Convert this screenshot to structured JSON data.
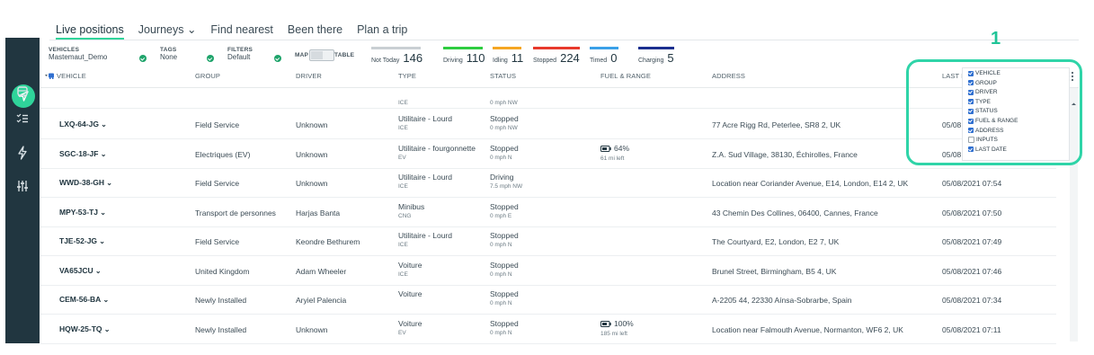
{
  "tabs": [
    {
      "label": "Live positions"
    },
    {
      "label": "Journeys ⌄"
    },
    {
      "label": "Find nearest"
    },
    {
      "label": "Been there"
    },
    {
      "label": "Plan a trip"
    }
  ],
  "filters": {
    "vehicles_label": "VEHICLES",
    "vehicles_value": "Mastemaut_Demo",
    "tags_label": "TAGS",
    "tags_value": "None",
    "filters_label": "FILTERS",
    "filters_value": "Default",
    "map_label": "MAP",
    "table_label": "TABLE"
  },
  "stats": [
    {
      "label": "Not Today",
      "count": "146",
      "color": "#c9cfd3"
    },
    {
      "label": "Driving",
      "count": "110",
      "color": "#2ecc40"
    },
    {
      "label": "Idling",
      "count": "11",
      "color": "#f5a623"
    },
    {
      "label": "Stopped",
      "count": "224",
      "color": "#e8392c"
    },
    {
      "label": "Timed",
      "count": "0",
      "color": "#3aa0e8"
    },
    {
      "label": "Charging",
      "count": "5",
      "color": "#1b2f8f"
    }
  ],
  "columns": {
    "vehicle": "VEHICLE",
    "group": "GROUP",
    "driver": "DRIVER",
    "type": "TYPE",
    "status": "STATUS",
    "fuel": "FUEL & RANGE",
    "address": "ADDRESS",
    "last_date": "LAST D"
  },
  "partial_row": {
    "type_sub": "ICE",
    "status_sub": "0 mph  NW"
  },
  "rows": [
    {
      "reg": "LXQ-64-JG",
      "group": "Field Service",
      "driver": "Unknown",
      "type": "Utilitaire - Lourd",
      "type_sub": "ICE",
      "status": "Stopped",
      "status_sub": "0 mph  NW",
      "fuel": "",
      "fuel_sub": "",
      "address": "77 Acre Rigg Rd, Peterlee, SR8 2, UK",
      "date": "05/08"
    },
    {
      "reg": "SGC-18-JF",
      "group": "Electriques (EV)",
      "driver": "Unknown",
      "type": "Utilitaire - fourgonnette",
      "type_sub": "EV",
      "status": "Stopped",
      "status_sub": "0 mph  N",
      "fuel": "64%",
      "fuel_sub": "61 mi left",
      "address": "Z.A. Sud Village, 38130, Échirolles, France",
      "date": "05/08"
    },
    {
      "reg": "WWD-38-GH",
      "group": "Field Service",
      "driver": "Unknown",
      "type": "Utilitaire - Lourd",
      "type_sub": "ICE",
      "status": "Driving",
      "status_sub": "7.5 mph  NW",
      "fuel": "",
      "fuel_sub": "",
      "address": "Location near Coriander Avenue, E14, London, E14 2, UK",
      "date": "05/08/2021 07:54"
    },
    {
      "reg": "MPY-53-TJ",
      "group": "Transport de personnes",
      "driver": "Harjas Banta",
      "type": "Minibus",
      "type_sub": "CNG",
      "status": "Stopped",
      "status_sub": "0 mph  E",
      "fuel": "",
      "fuel_sub": "",
      "address": "43 Chemin Des Collines, 06400, Cannes, France",
      "date": "05/08/2021 07:50"
    },
    {
      "reg": "TJE-52-JG",
      "group": "Field Service",
      "driver": "Keondre Bethurem",
      "type": "Utilitaire - Lourd",
      "type_sub": "ICE",
      "status": "Stopped",
      "status_sub": "0 mph  N",
      "fuel": "",
      "fuel_sub": "",
      "address": "The Courtyard, E2, London, E2 7, UK",
      "date": "05/08/2021 07:49"
    },
    {
      "reg": "VA65JCU",
      "group": "United Kingdom",
      "driver": "Adam Wheeler",
      "type": "Voiture",
      "type_sub": "ICE",
      "status": "Stopped",
      "status_sub": "0 mph  N",
      "fuel": "",
      "fuel_sub": "",
      "address": "Brunel Street, Birmingham, B5 4, UK",
      "date": "05/08/2021 07:46"
    },
    {
      "reg": "CEM-56-BA",
      "group": "Newly Installed",
      "driver": "Aryiel Palencia",
      "type": "Voiture",
      "type_sub": "",
      "status": "Stopped",
      "status_sub": "0 mph  N",
      "fuel": "",
      "fuel_sub": "",
      "address": "A-2205 44, 22330 Aínsa-Sobrarbe, Spain",
      "date": "05/08/2021 07:34"
    },
    {
      "reg": "HQW-25-TQ",
      "group": "Newly Installed",
      "driver": "Unknown",
      "type": "Voiture",
      "type_sub": "EV",
      "status": "Stopped",
      "status_sub": "0 mph  N",
      "fuel": "100%",
      "fuel_sub": "185 mi left",
      "address": "Location near Falmouth Avenue, Normanton, WF6 2, UK",
      "date": "05/08/2021 07:11"
    }
  ],
  "column_chooser": {
    "options": [
      {
        "label": "VEHICLE",
        "checked": true
      },
      {
        "label": "GROUP",
        "checked": true
      },
      {
        "label": "DRIVER",
        "checked": true
      },
      {
        "label": "TYPE",
        "checked": true
      },
      {
        "label": "STATUS",
        "checked": true
      },
      {
        "label": "FUEL & RANGE",
        "checked": true
      },
      {
        "label": "ADDRESS",
        "checked": true
      },
      {
        "label": "INPUTS",
        "checked": false
      },
      {
        "label": "LAST DATE",
        "checked": true
      }
    ]
  },
  "annotation": {
    "number": "1",
    "color": "#2fd4a8"
  },
  "icons": [
    "navigation-icon",
    "car-icon",
    "checklist-icon",
    "lightning-icon",
    "sliders-icon",
    "battery-icon",
    "kebab-menu-icon"
  ]
}
